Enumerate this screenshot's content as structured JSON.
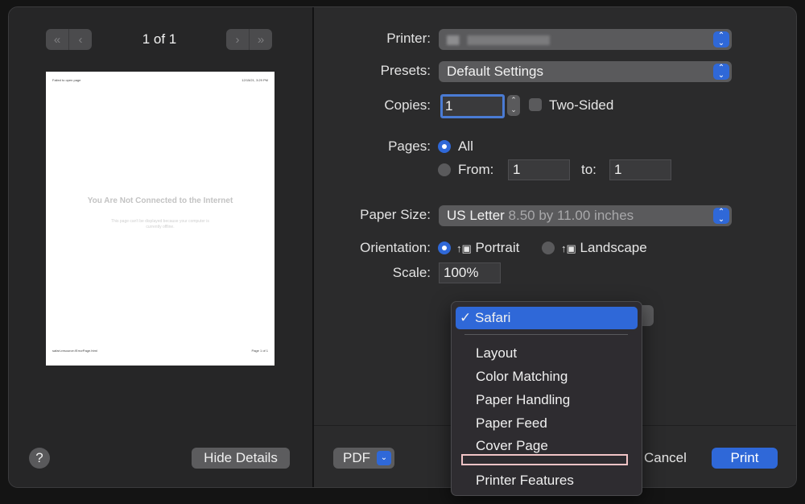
{
  "preview": {
    "page_count": "1 of 1",
    "header_left": "Failed to open page",
    "header_right": "12/15/21, 3:29 PM",
    "message_title": "You Are Not Connected to the Internet",
    "message_body": "This page can't be displayed because your computer is currently offline.",
    "footer_left": "safari-resource:/ErrorPage.html",
    "footer_right": "Page 1 of 1"
  },
  "left_footer": {
    "help_label": "?",
    "hide_details_label": "Hide Details"
  },
  "settings": {
    "printer_label": "Printer:",
    "presets_label": "Presets:",
    "presets_value": "Default Settings",
    "copies_label": "Copies:",
    "copies_value": "1",
    "two_sided_label": "Two-Sided",
    "pages_label": "Pages:",
    "pages_all_label": "All",
    "pages_from_label": "From:",
    "pages_from_value": "1",
    "pages_to_label": "to:",
    "pages_to_value": "1",
    "paper_size_label": "Paper Size:",
    "paper_size_value": "US Letter",
    "paper_size_detail": "8.50 by 11.00 inches",
    "orientation_label": "Orientation:",
    "portrait_label": "Portrait",
    "landscape_label": "Landscape",
    "scale_label": "Scale:",
    "scale_value": "100%"
  },
  "footer": {
    "pdf_label": "PDF",
    "cancel_label": "Cancel",
    "print_label": "Print"
  },
  "menu": {
    "selected": "Safari",
    "items": [
      "Layout",
      "Color Matching",
      "Paper Handling",
      "Paper Feed",
      "Cover Page"
    ],
    "last_item": "Printer Features"
  },
  "colors": {
    "accent": "#2f68d8",
    "dialog_bg": "#2b2b2c",
    "highlight_outline": "#f1c4c6"
  }
}
